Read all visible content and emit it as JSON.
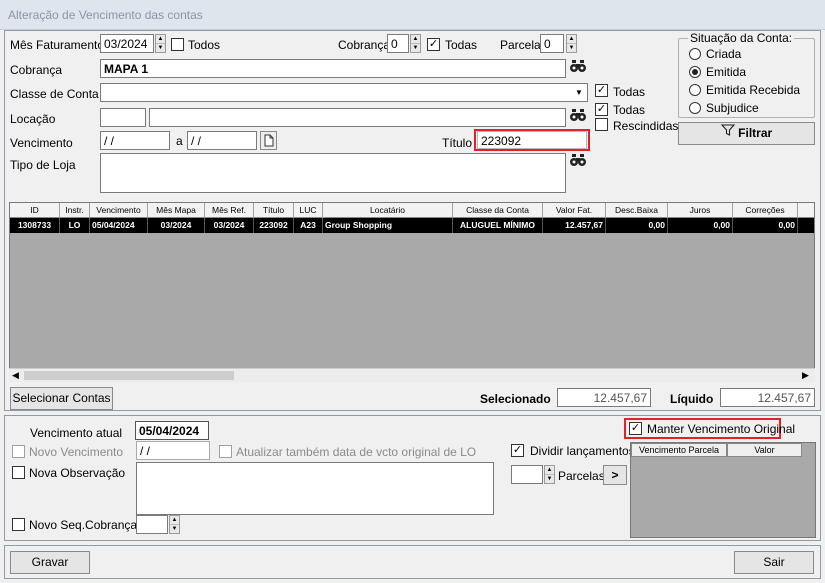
{
  "window": {
    "title": "Alteração de Vencimento das contas"
  },
  "filters": {
    "mes_faturamento_label": "Mês Faturamento",
    "mes_faturamento_value": "03/2024",
    "todos_label": "Todos",
    "cobranca_num_label": "Cobrança",
    "cobranca_num_value": "0",
    "todas_label": "Todas",
    "parcela_label": "Parcela",
    "parcela_value": "0",
    "cobranca_label": "Cobrança",
    "cobranca_value": "MAPA 1",
    "classe_conta_label": "Classe de Conta",
    "classe_conta_value": "",
    "classe_todas_label": "Todas",
    "locacao_label": "Locação",
    "locacao_todas_label": "Todas",
    "rescindidas_label": "Rescindidas",
    "vencimento_label": "Vencimento",
    "vencimento_de": " / /",
    "vencimento_a_label": "a",
    "vencimento_ate": " / /",
    "titulo_label": "Título",
    "titulo_value": "223092",
    "tipo_loja_label": "Tipo de Loja"
  },
  "situacao": {
    "title": "Situação da Conta:",
    "options": [
      "Criada",
      "Emitida",
      "Emitida Recebida",
      "Subjudice"
    ],
    "selected": "Emitida"
  },
  "filtrar_label": "Filtrar",
  "table": {
    "headers": [
      "ID",
      "Instr.",
      "Vencimento",
      "Mês Mapa",
      "Mês Ref.",
      "Título",
      "LUC",
      "Locatário",
      "Classe da Conta",
      "Valor Fat.",
      "Desc.Baixa",
      "Juros",
      "Correções"
    ],
    "rows": [
      [
        "1308733",
        "LO",
        "05/04/2024",
        "03/2024",
        "03/2024",
        "223092",
        "A23",
        "Group Shopping",
        "ALUGUEL MÍNIMO",
        "12.457,67",
        "0,00",
        "0,00",
        "0,00"
      ]
    ]
  },
  "summary": {
    "selecionar_label": "Selecionar Contas",
    "selecionado_label": "Selecionado",
    "selecionado_value": "12.457,67",
    "liquido_label": "Líquido",
    "liquido_value": "12.457,67"
  },
  "bottom": {
    "venc_atual_label": "Vencimento atual",
    "venc_atual_value": "05/04/2024",
    "manter_label": "Manter Vencimento Original",
    "novo_venc_label": "Novo Vencimento",
    "novo_venc_value": " / /",
    "atualizar_label": "Atualizar também data de vcto original de LO",
    "dividir_label": "Dividir lançamentos",
    "nova_obs_label": "Nova Observação",
    "parcelas_label": "Parcelas",
    "parcela_headers": [
      "Vencimento Parcela",
      "Valor"
    ],
    "novo_seq_label": "Novo Seq.Cobrança"
  },
  "footer": {
    "gravar_label": "Gravar",
    "sair_label": "Sair"
  }
}
